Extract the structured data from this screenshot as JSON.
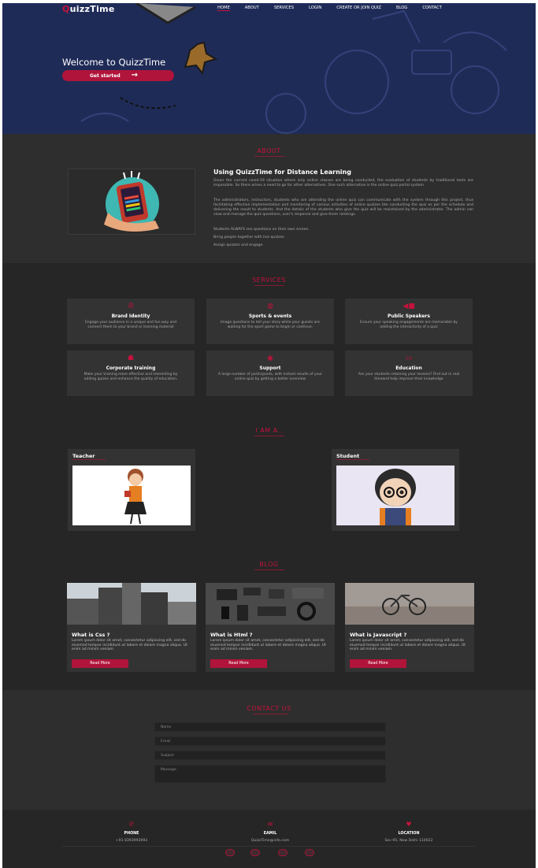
{
  "brand": {
    "logo_prefix": "Q",
    "logo_rest": "uizzTime"
  },
  "nav": [
    "HOME",
    "ABOUT",
    "SERVICES",
    "LOGIN",
    "CREATE OR JOIN QUIZ",
    "BLOG",
    "CONTACT"
  ],
  "hero": {
    "welcome": "Welcome to QuizzTime",
    "cta": "Get started",
    "cta_icon": "arrow-right-icon"
  },
  "about": {
    "title": "ABOUT",
    "heading": "Using QuizzTime for Distance Learning",
    "p1": "Given the current covid-19 situation where only online classes are being conducted, the evaluation of students by traditional tests are impossible. So there arises a need to go for other alternatives. One such alternative is the online quiz portal system.",
    "p2": "The administrators, instructors, students who are attending the online quiz can communicate with the system through this project, thus facilitating effective implementation and monitoring of various activities of online quizzes like conducting the quiz as per the schedule and delivering the result to students. And the details of the students who give the quiz will be maintained by the administrator. The admin can view and manage the quiz questions, user's response and give them rankings.",
    "p3": "Students ALWAYS see questions on their own screen.",
    "p4": "Bring people together with live quizzes",
    "p5": "Assign quizzes and engage"
  },
  "services": {
    "title": "SERVICES",
    "items": [
      {
        "icon": "bullhorn-icon",
        "title": "Brand Identity",
        "desc": "Engage your audience in a unique and fun way and connect them to your brand or learning material"
      },
      {
        "icon": "basketball-icon",
        "title": "Sports & events",
        "desc": "Image questions to tell your story while your guests are waiting for the sport game to begin or continue."
      },
      {
        "icon": "megaphone-icon",
        "title": "Public Speakers",
        "desc": "Ensure your speaking engagements are memorable by adding the interactivity of a quiz"
      },
      {
        "icon": "user-tie-icon",
        "title": "Corporate training",
        "desc": "Make your training more effective and interesting by adding quizes and enhance the quality of education."
      },
      {
        "icon": "headset-icon",
        "title": "Support",
        "desc": "A large number of participants, with instant results of your online quiz by getting a better overview"
      },
      {
        "icon": "laptop-icon",
        "title": "Education",
        "desc": "Are your students retaining your lessons? Find out in real timeand help improve their knowledge"
      }
    ]
  },
  "iam": {
    "title": "I AM A..",
    "cards": [
      {
        "label": "Teacher"
      },
      {
        "label": "Student"
      }
    ]
  },
  "blog": {
    "title": "BLOG",
    "read_more": "Read More",
    "posts": [
      {
        "title": "What is Css ?",
        "desc": "Lorem ipsum dolor sit amet, consectetur adipiscing elit, sed do eiusmod tempor incididunt ut labore et dolore magna aliqua. Ut enim ad minim veniam."
      },
      {
        "title": "What is Html ?",
        "desc": "Lorem ipsum dolor sit amet, consectetur adipiscing elit, sed do eiusmod tempor incididunt ut labore et dolore magna aliqua. Ut enim ad minim veniam."
      },
      {
        "title": "What is Javascript ?",
        "desc": "Lorem ipsum dolor sit amet, consectetur adipiscing elit, sed do eiusmod tempor incididunt ut labore et dolore magna aliqua. Ut enim ad minim veniam."
      }
    ]
  },
  "contact": {
    "title": "CONTACT US",
    "name_ph": "Name",
    "email_ph": "Email",
    "subject_ph": "Subject",
    "message_ph": "Message"
  },
  "footer": {
    "phone_label": "PHONE",
    "phone": "+91 8393993993",
    "email_label": "EAMIL",
    "email": "QuizzTime@info.com",
    "location_label": "LOCATION",
    "location": "Sec-95, New Delhi 110022"
  },
  "colors": {
    "accent": "#c4123c",
    "bg": "#262626",
    "hero": "#232f5c"
  }
}
